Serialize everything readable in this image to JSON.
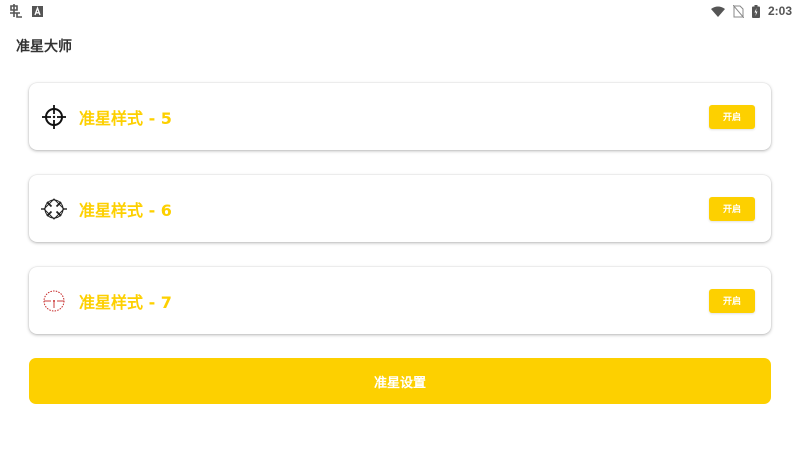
{
  "status_bar": {
    "time": "2:03",
    "left_icons": [
      "app-notification-icon",
      "a-letter-notification-icon"
    ],
    "right_icons": [
      "wifi-icon",
      "no-sim-icon",
      "battery-icon"
    ]
  },
  "app": {
    "title": "准星大师"
  },
  "crosshairs": [
    {
      "label": "准星样式 - 5",
      "button": "开启",
      "icon": "crosshair-circle-icon"
    },
    {
      "label": "准星样式 - 6",
      "button": "开启",
      "icon": "crosshair-diamond-icon"
    },
    {
      "label": "准星样式 - 7",
      "button": "开启",
      "icon": "crosshair-red-dot-icon"
    }
  ],
  "settings_button": "准星设置",
  "colors": {
    "accent": "#FDD000",
    "background": "#FFFFFF",
    "title_text": "#333333"
  }
}
